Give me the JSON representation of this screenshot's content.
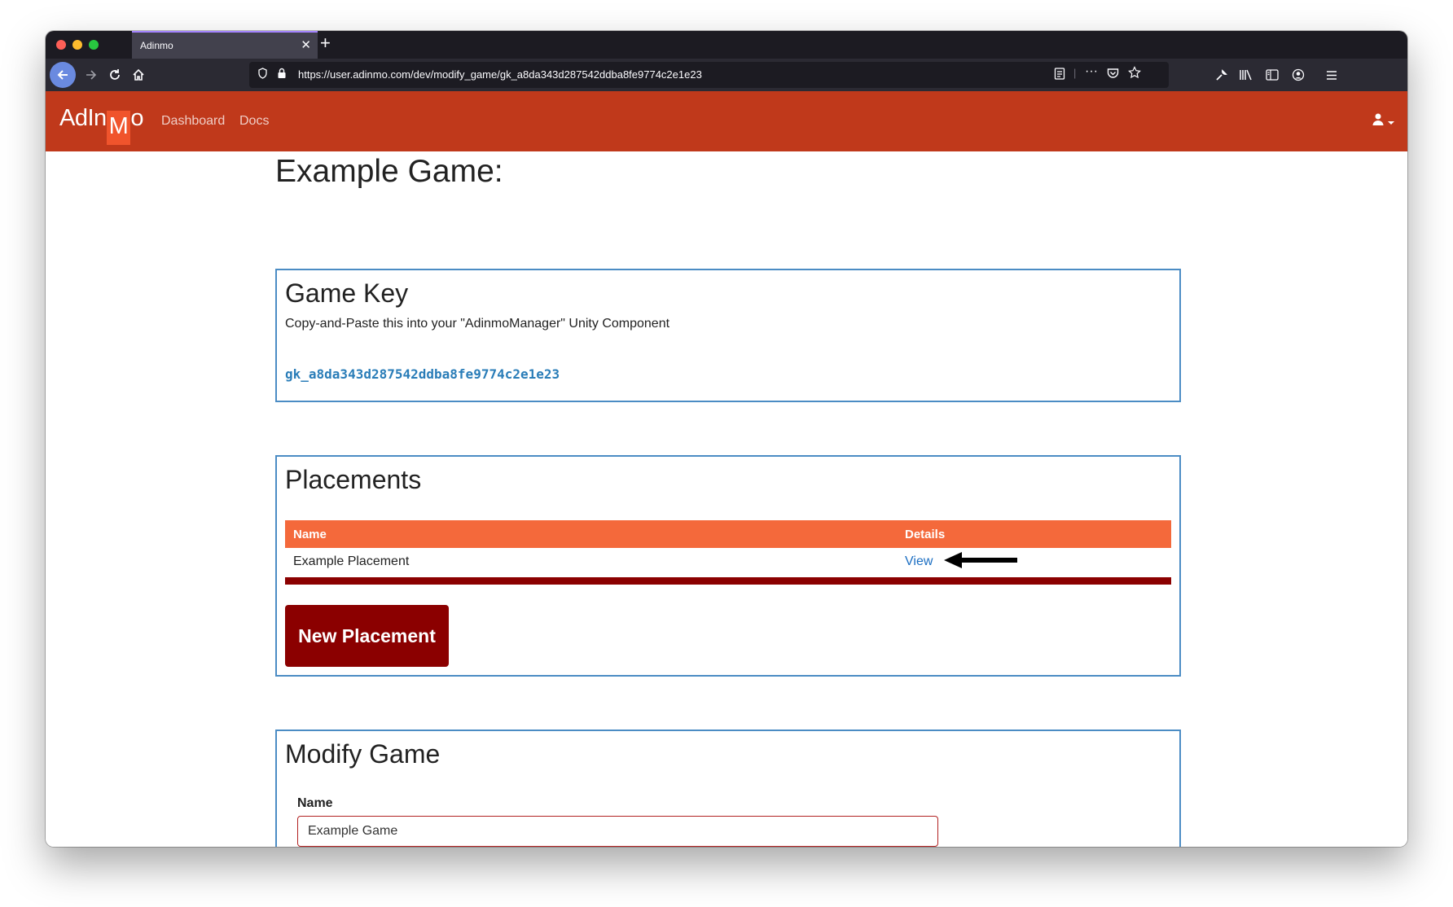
{
  "browser": {
    "tab_title": "Adinmo",
    "tab_close": "✕",
    "new_tab": "+",
    "url": "https://user.adinmo.com/dev/modify_game/gk_a8da343d287542ddba8fe9774c2e1e23"
  },
  "nav": {
    "logo_prefix": "AdIn",
    "logo_m": "M",
    "logo_suffix": "o",
    "links": [
      "Dashboard",
      "Docs"
    ]
  },
  "page": {
    "title": "Example Game:"
  },
  "game_key": {
    "heading": "Game Key",
    "description": "Copy-and-Paste this into your \"AdinmoManager\" Unity Component",
    "key": "gk_a8da343d287542ddba8fe9774c2e1e23"
  },
  "placements": {
    "heading": "Placements",
    "columns": [
      "Name",
      "Details"
    ],
    "rows": [
      {
        "name": "Example Placement",
        "details": "View"
      }
    ],
    "new_button": "New Placement"
  },
  "modify_game": {
    "heading": "Modify Game",
    "name_label": "Name",
    "name_value": "Example Game"
  },
  "colors": {
    "navbar": "#c0391b",
    "table_header": "#f4693b",
    "button": "#8b0000",
    "card_border": "#4b8cc4",
    "link": "#1b6ec2"
  }
}
